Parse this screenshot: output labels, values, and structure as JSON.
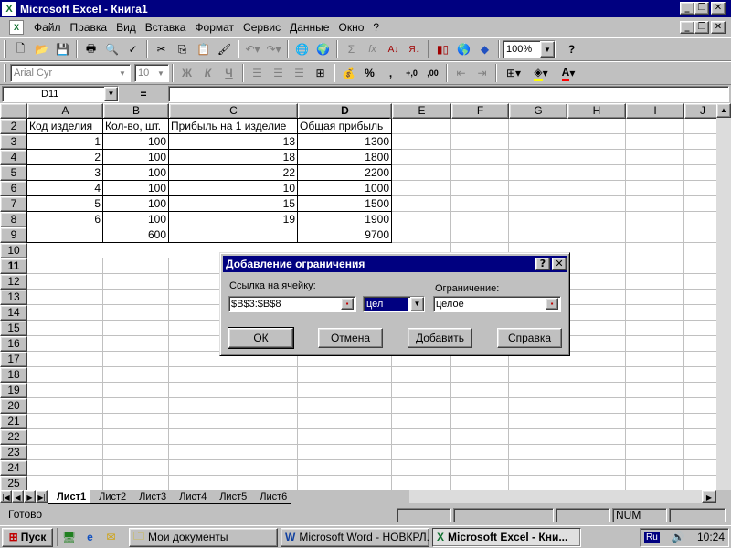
{
  "window": {
    "title": "Microsoft Excel - Книга1",
    "app_icon": "excel-icon"
  },
  "menu": [
    "Файл",
    "Правка",
    "Вид",
    "Вставка",
    "Формат",
    "Сервис",
    "Данные",
    "Окно",
    "?"
  ],
  "toolbar": {
    "zoom": "100%",
    "font_name": "Arial Cyr",
    "font_size": "10",
    "bold": "Ж",
    "italic": "К",
    "underline": "Ч",
    "sum": "Σ",
    "fx": "fx",
    "percent": "%",
    "comma": ",",
    "dec_inc": "+,0",
    "dec_dec": ",00",
    "help": "?"
  },
  "formula_bar": {
    "name_box": "D11",
    "equals": "=",
    "formula": ""
  },
  "columns": [
    "A",
    "B",
    "C",
    "D",
    "E",
    "F",
    "G",
    "H",
    "I",
    "J"
  ],
  "rows": [
    "2",
    "3",
    "4",
    "5",
    "6",
    "7",
    "8",
    "9",
    "10",
    "11",
    "12",
    "13",
    "14",
    "15",
    "16",
    "17",
    "18",
    "19",
    "20",
    "21",
    "22",
    "23",
    "24",
    "25"
  ],
  "table": {
    "headers": [
      "Код изделия",
      "Кол-во, шт.",
      "Прибыль на 1 изделие",
      "Общая прибыль"
    ],
    "rows": [
      [
        "1",
        "100",
        "13",
        "1300"
      ],
      [
        "2",
        "100",
        "18",
        "1800"
      ],
      [
        "3",
        "100",
        "22",
        "2200"
      ],
      [
        "4",
        "100",
        "10",
        "1000"
      ],
      [
        "5",
        "100",
        "15",
        "1500"
      ],
      [
        "6",
        "100",
        "19",
        "1900"
      ]
    ],
    "totals": [
      "",
      "600",
      "",
      "9700"
    ]
  },
  "sheets": [
    "Лист1",
    "Лист2",
    "Лист3",
    "Лист4",
    "Лист5",
    "Лист6"
  ],
  "status": {
    "ready": "Готово",
    "num": "NUM"
  },
  "dialog": {
    "title": "Добавление ограничения",
    "cell_ref_label": "Ссылка на ячейку:",
    "cell_ref_value": "$B$3:$B$8",
    "operator_value": "цел",
    "constraint_label": "Ограничение:",
    "constraint_value": "целое",
    "buttons": {
      "ok": "ОК",
      "cancel": "Отмена",
      "add": "Добавить",
      "help": "Справка"
    }
  },
  "taskbar": {
    "start": "Пуск",
    "tasks": [
      "Мои документы",
      "Microsoft Word - НОВКРЛ...",
      "Microsoft Excel - Кни..."
    ],
    "lang": "Ru",
    "clock": "10:24"
  }
}
